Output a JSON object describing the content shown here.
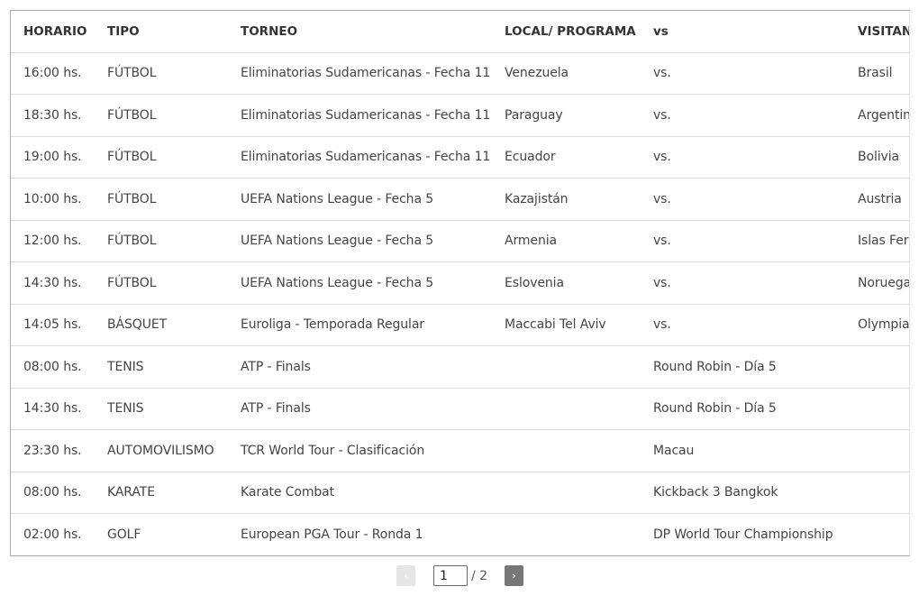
{
  "table": {
    "headers": {
      "horario": "HORARIO",
      "tipo": "TIPO",
      "torneo": "TORNEO",
      "local": "LOCAL/ PROGRAMA",
      "vs": "vs",
      "visitante": "VISITANTE"
    },
    "rows": [
      {
        "horario": "16:00 hs.",
        "tipo": "FÚTBOL",
        "torneo": "Eliminatorias Sudamericanas - Fecha 11",
        "local": "Venezuela",
        "vs": "vs.",
        "visitante": "Brasil"
      },
      {
        "horario": "18:30 hs.",
        "tipo": "FÚTBOL",
        "torneo": "Eliminatorias Sudamericanas - Fecha 11",
        "local": "Paraguay",
        "vs": "vs.",
        "visitante": "Argentina"
      },
      {
        "horario": "19:00 hs.",
        "tipo": "FÚTBOL",
        "torneo": "Eliminatorias Sudamericanas - Fecha 11",
        "local": "Ecuador",
        "vs": "vs.",
        "visitante": "Bolivia"
      },
      {
        "horario": "10:00 hs.",
        "tipo": "FÚTBOL",
        "torneo": "UEFA Nations League - Fecha 5",
        "local": "Kazajistán",
        "vs": "vs.",
        "visitante": "Austria"
      },
      {
        "horario": "12:00 hs.",
        "tipo": "FÚTBOL",
        "torneo": "UEFA Nations League - Fecha 5",
        "local": "Armenia",
        "vs": "vs.",
        "visitante": "Islas Feroe"
      },
      {
        "horario": "14:30 hs.",
        "tipo": "FÚTBOL",
        "torneo": "UEFA Nations League - Fecha 5",
        "local": "Eslovenia",
        "vs": "vs.",
        "visitante": "Noruega"
      },
      {
        "horario": "14:05 hs.",
        "tipo": "BÁSQUET",
        "torneo": "Euroliga - Temporada Regular",
        "local": "Maccabi Tel Aviv",
        "vs": "vs.",
        "visitante": "Olympiakos"
      },
      {
        "horario": "08:00 hs.",
        "tipo": "TENIS",
        "torneo": "ATP - Finals",
        "local": "",
        "vs": "Round Robin - Día 5",
        "visitante": ""
      },
      {
        "horario": "14:30 hs.",
        "tipo": "TENIS",
        "torneo": "ATP - Finals",
        "local": "",
        "vs": "Round Robin - Día 5",
        "visitante": ""
      },
      {
        "horario": "23:30 hs.",
        "tipo": "AUTOMOVILISMO",
        "torneo": "TCR World Tour - Clasificación",
        "local": "",
        "vs": "Macau",
        "visitante": ""
      },
      {
        "horario": "08:00 hs.",
        "tipo": "KARATE",
        "torneo": "Karate Combat",
        "local": "",
        "vs": "Kickback 3 Bangkok",
        "visitante": ""
      },
      {
        "horario": "02:00 hs.",
        "tipo": "GOLF",
        "torneo": "European PGA Tour - Ronda 1",
        "local": "",
        "vs": "DP World Tour Championship",
        "visitante": ""
      }
    ]
  },
  "pagination": {
    "prev_icon": "‹",
    "next_icon": "›",
    "current_page": "1",
    "total_label": "/ 2"
  }
}
